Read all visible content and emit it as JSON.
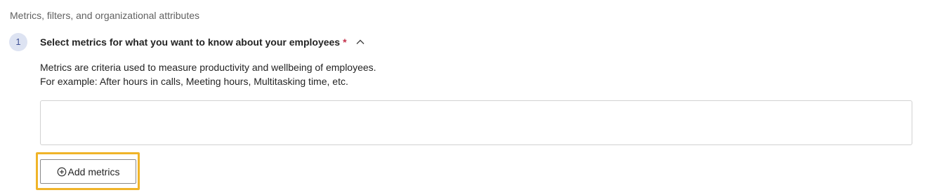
{
  "section": {
    "title": "Metrics, filters, and organizational attributes"
  },
  "step": {
    "number": "1",
    "heading": "Select metrics for what you want to know about your employees",
    "required_marker": "*",
    "description_line1": "Metrics are criteria used to measure productivity and wellbeing of employees.",
    "description_line2": "For example: After hours in calls, Meeting hours, Multitasking time, etc."
  },
  "actions": {
    "add_metrics_label": "Add metrics",
    "add_metrics_icon": "add-circle-icon"
  },
  "colors": {
    "focus_highlight": "#f0b429",
    "required": "#c4314b",
    "badge_bg": "#dde3f2"
  }
}
